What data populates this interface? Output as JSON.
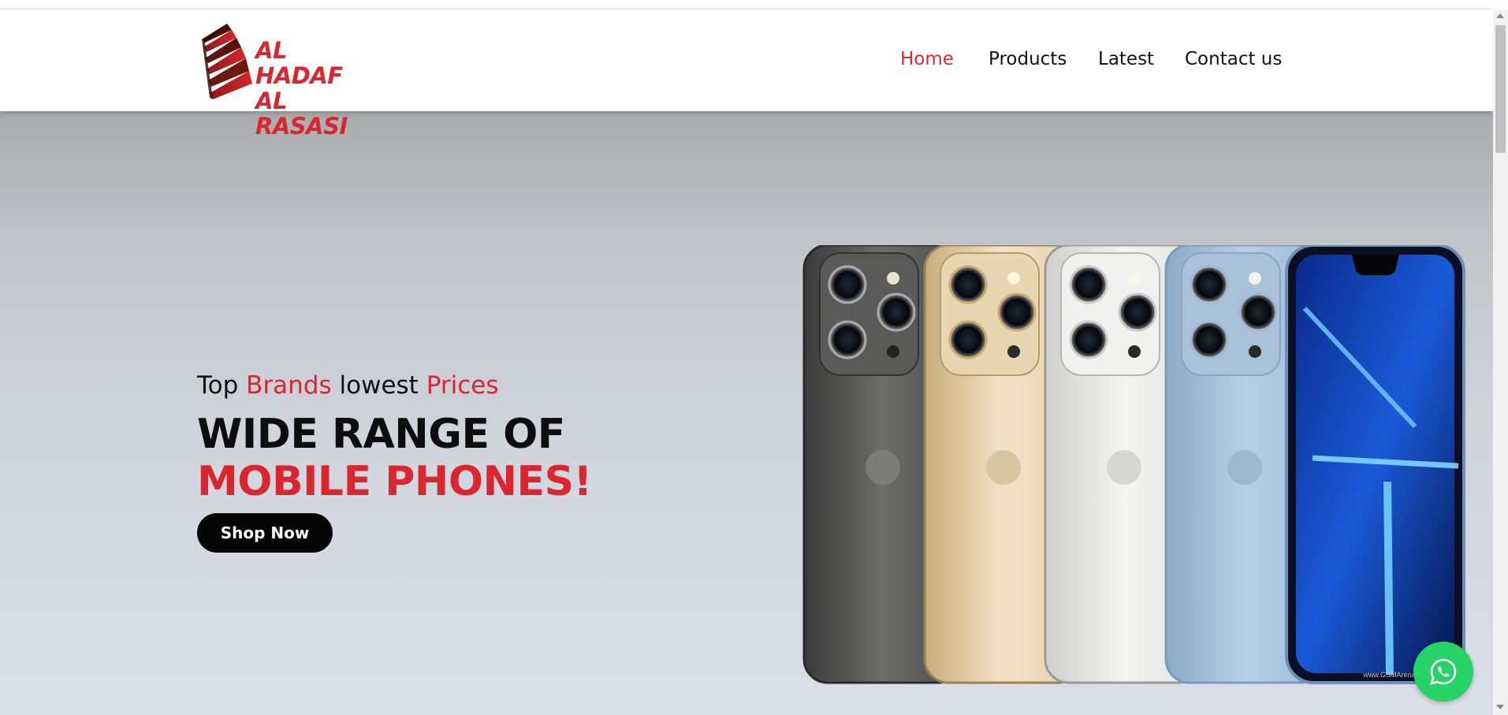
{
  "brand": {
    "line1": "AL HADAF",
    "line2": "AL RASASI",
    "logo_icon": "stacked-stripes-logo",
    "color": "#d9262f"
  },
  "nav": [
    {
      "label": "Home",
      "active": true
    },
    {
      "label": "Products",
      "active": false
    },
    {
      "label": "Latest",
      "active": false
    },
    {
      "label": "Contact us",
      "active": false
    }
  ],
  "hero": {
    "tagline": {
      "part1": "Top ",
      "part2": "Brands",
      "part3": " lowest ",
      "part4": "Prices"
    },
    "headline": {
      "part1": "WIDE RANGE OF ",
      "part2": "MOBILE PHONES!"
    },
    "cta_label": "Shop Now",
    "image_watermark": "www.GSMArena.com",
    "image_subject": "phones-row-image"
  },
  "colors": {
    "accent": "#d9262f",
    "button": "#050505",
    "whatsapp": "#25d366"
  },
  "floating": {
    "icon": "whatsapp-icon"
  }
}
